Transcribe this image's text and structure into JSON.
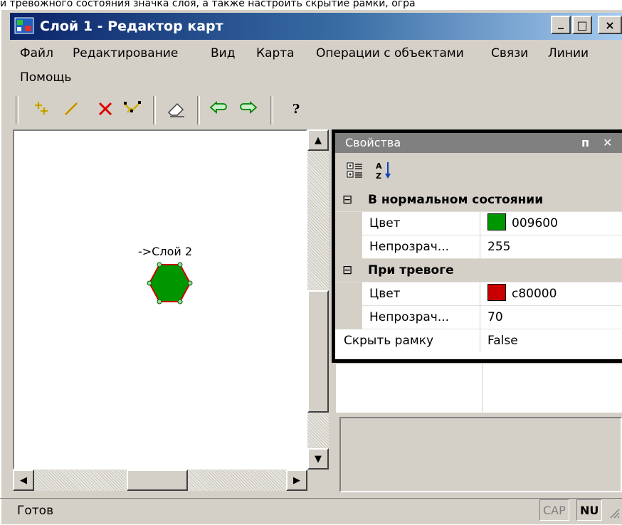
{
  "doc_fragment": "и тревожного состояния значка слоя, а также настроить скрытие рамки, огра",
  "window": {
    "title": "Слой 1 - Редактор карт",
    "minimize": "_",
    "maximize": "□",
    "close": "×"
  },
  "menu": [
    "Файл",
    "Редактирование",
    "Вид",
    "Карта",
    "Операции с объектами",
    "Связи",
    "Линии",
    "Помощь"
  ],
  "toolbar": [
    {
      "icon": "add-point-icon"
    },
    {
      "icon": "draw-line-icon"
    },
    {
      "icon": "delete-icon"
    },
    {
      "icon": "edit-nodes-icon"
    },
    {
      "icon": "eraser-icon"
    },
    {
      "icon": "undo-icon"
    },
    {
      "icon": "redo-icon"
    },
    {
      "icon": "help-icon",
      "glyph": "?"
    }
  ],
  "canvas": {
    "layer_label": "->Слой 2",
    "hexagon_fill": "#009600",
    "hexagon_stroke": "#c80000"
  },
  "properties": {
    "title": "Свойства",
    "pin": "ᴨ",
    "close": "✕",
    "normal_category": "В нормальном состоянии",
    "normal_color_label": "Цвет",
    "normal_color_value": "009600",
    "normal_color_hex": "#009600",
    "normal_opacity_label": "Непрозрач...",
    "normal_opacity_value": "255",
    "alarm_category": "При тревоге",
    "alarm_color_label": "Цвет",
    "alarm_color_value": "c80000",
    "alarm_color_hex": "#c80000",
    "alarm_opacity_label": "Непрозрач...",
    "alarm_opacity_value": "70",
    "hide_frame_label": "Скрыть рамку",
    "hide_frame_value": "False",
    "collapse_glyph": "⊟"
  },
  "status": {
    "text": "Готов",
    "cap": "CAP",
    "num": "NU"
  }
}
